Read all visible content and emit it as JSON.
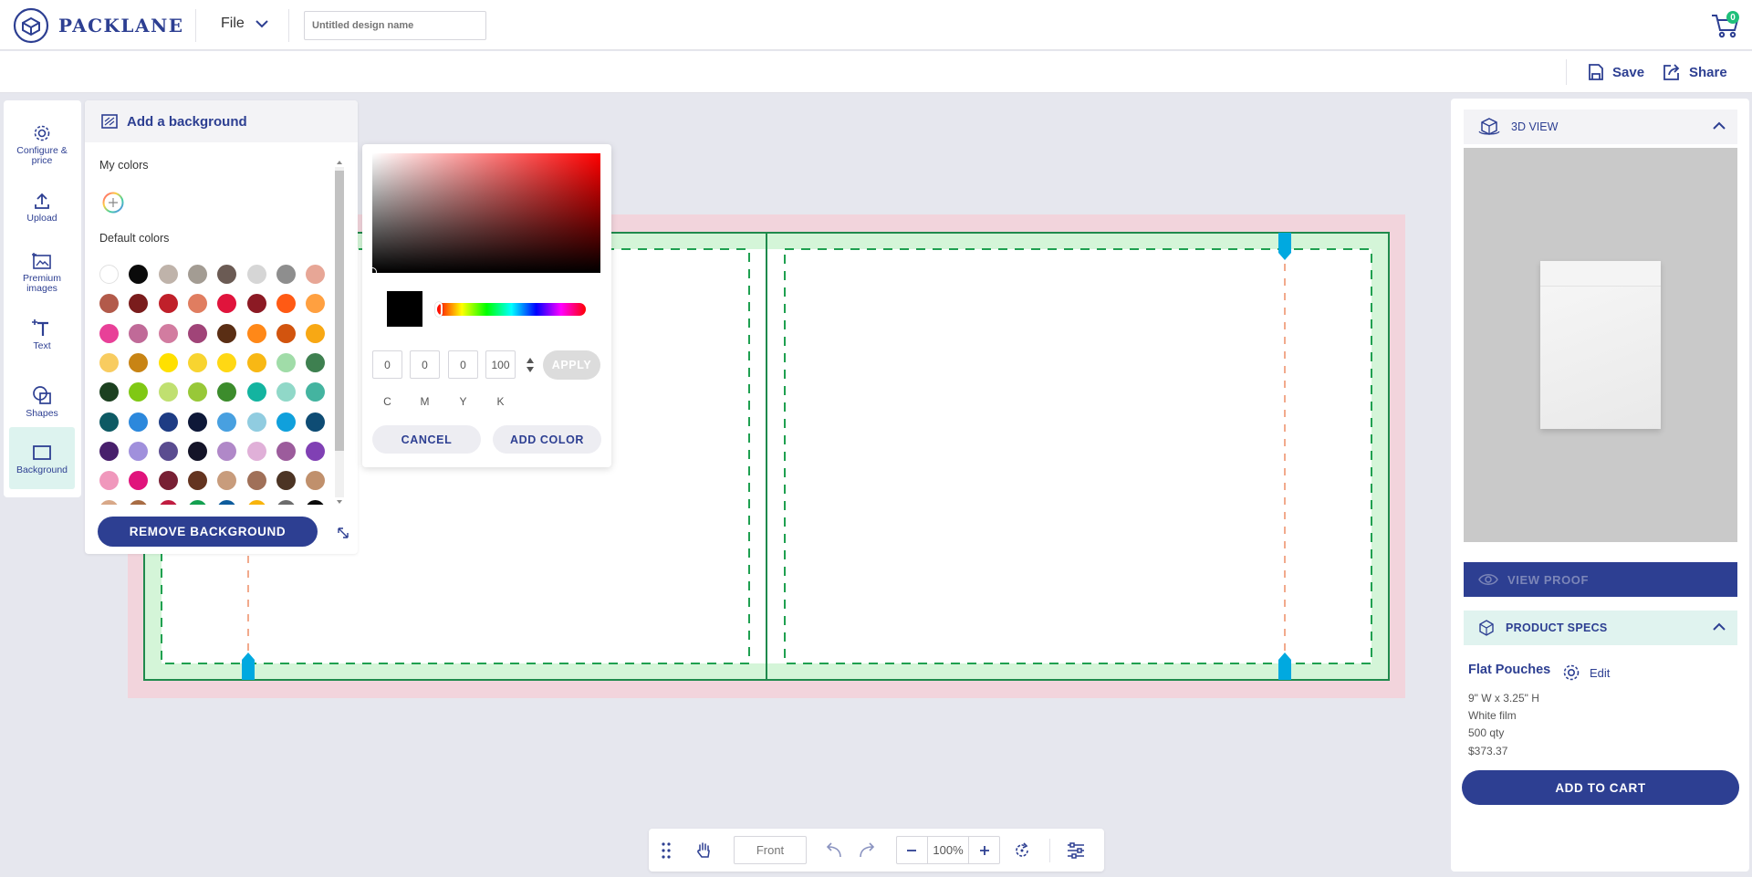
{
  "brand": {
    "name": "PACKLANE"
  },
  "header": {
    "file_label": "File",
    "design_name_placeholder": "Untitled design name",
    "cart_count": "0"
  },
  "subbar": {
    "save_label": "Save",
    "share_label": "Share"
  },
  "left_tools": [
    {
      "label": "Configure & price",
      "icon": "gear-icon"
    },
    {
      "label": "Upload",
      "icon": "upload-icon"
    },
    {
      "label": "Premium images",
      "icon": "image-icon"
    },
    {
      "label": "Text",
      "icon": "text-icon"
    },
    {
      "label": "Shapes",
      "icon": "shapes-icon"
    },
    {
      "label": "Background",
      "icon": "square-icon",
      "active": true
    }
  ],
  "background_panel": {
    "title": "Add a background",
    "my_colors_label": "My colors",
    "default_colors_label": "Default colors",
    "remove_label": "REMOVE BACKGROUND",
    "swatches": [
      "#ffffff",
      "#0a0a0a",
      "#bfb3aa",
      "#a39c93",
      "#6b5b54",
      "#d6d6d6",
      "#8e8e8e",
      "#e7a696",
      "#b25a4a",
      "#7a1c1c",
      "#c0202a",
      "#e07d60",
      "#e0143c",
      "#8c1a24",
      "#ff5a14",
      "#ffa040",
      "#e84098",
      "#c06a98",
      "#d27ca0",
      "#a04478",
      "#5a2e14",
      "#ff8818",
      "#d2540e",
      "#f8a814",
      "#f8cc60",
      "#c88414",
      "#ffe000",
      "#f8d430",
      "#ffd814",
      "#f8b814",
      "#a0dca8",
      "#3e8050",
      "#1c4020",
      "#80c814",
      "#c0e070",
      "#98c838",
      "#3c8c2c",
      "#14b4a0",
      "#90d8c8",
      "#44b4a0",
      "#0e5a64",
      "#2c88dc",
      "#1e3c84",
      "#0e1838",
      "#48a0e0",
      "#90cce0",
      "#10a0dc",
      "#0e4c74",
      "#48206c",
      "#a090dc",
      "#5a4c90",
      "#141428",
      "#b088c8",
      "#e0b0d8",
      "#9c5c9c",
      "#8040b4",
      "#f098bc",
      "#e0147c",
      "#782034",
      "#643420",
      "#c89c7c",
      "#a07058",
      "#4c3424",
      "#c0906c",
      "#d8a888",
      "#a86c44",
      "#c01c40",
      "#14a050",
      "#0e5c9c",
      "#f8b40c",
      "#6c6c6c",
      "#0a0a0a"
    ]
  },
  "color_picker": {
    "current_color": "#000000",
    "cmyk": {
      "c": "0",
      "m": "0",
      "y": "0",
      "k": "100"
    },
    "labels": {
      "c": "C",
      "m": "M",
      "y": "Y",
      "k": "K"
    },
    "apply_label": "APPLY",
    "cancel_label": "CANCEL",
    "add_color_label": "ADD COLOR"
  },
  "right_panel": {
    "view3d_label": "3D VIEW",
    "view_proof_label": "VIEW PROOF",
    "product_specs_label": "PRODUCT SPECS",
    "product_name": "Flat Pouches",
    "edit_label": "Edit",
    "specs": [
      "9\" W x 3.25\" H",
      "White film",
      "500 qty",
      "$373.37"
    ],
    "add_to_cart_label": "ADD TO CART"
  },
  "bottom_bar": {
    "face": "Front",
    "zoom": "100%"
  },
  "colors": {
    "brand": "#2d3f92",
    "accent_teal": "#00a9e0",
    "safe_zone": "#d4f5d8",
    "bleed": "#f2d4dc"
  }
}
